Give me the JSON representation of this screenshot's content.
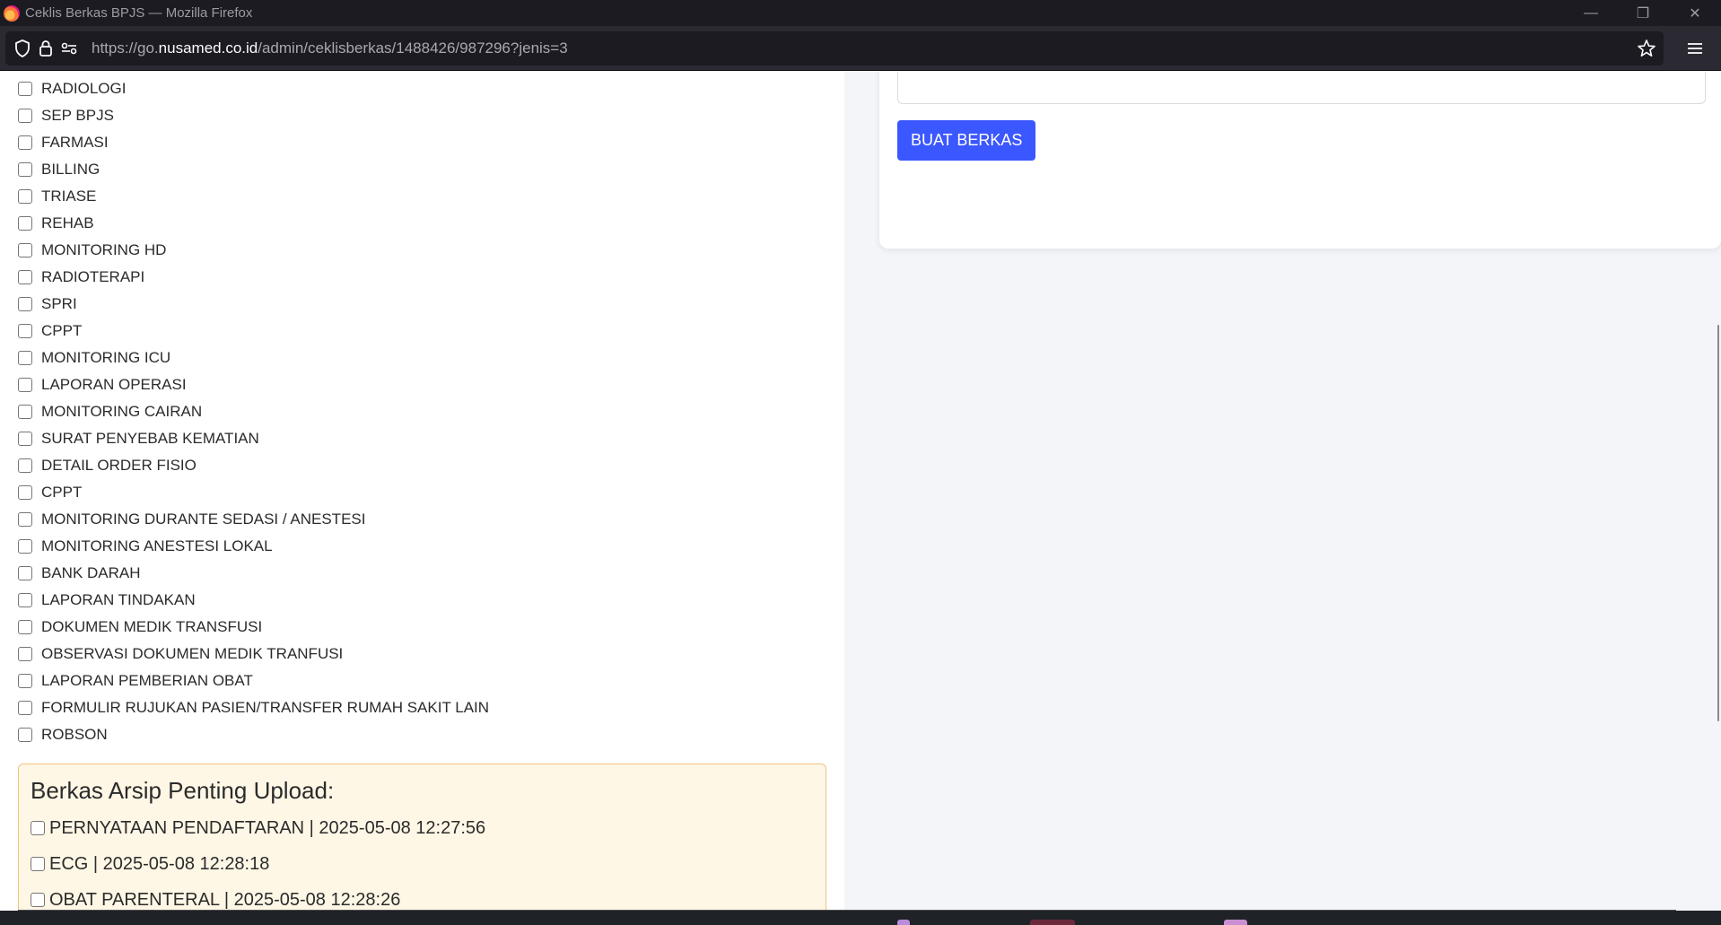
{
  "window": {
    "title": "Ceklis Berkas BPJS — Mozilla Firefox",
    "minimize": "—",
    "restore": "❐",
    "close": "✕"
  },
  "navbar": {
    "url_prefix": "https://go.",
    "url_host": "nusamed.co.id",
    "url_path": "/admin/ceklisberkas/1488426/987296?jenis=3"
  },
  "checklist": {
    "items": [
      {
        "label": "RADIOLOGI",
        "checked": false
      },
      {
        "label": "SEP BPJS",
        "checked": false
      },
      {
        "label": "FARMASI",
        "checked": false
      },
      {
        "label": "BILLING",
        "checked": false
      },
      {
        "label": "TRIASE",
        "checked": false
      },
      {
        "label": "REHAB",
        "checked": false
      },
      {
        "label": "MONITORING HD",
        "checked": false
      },
      {
        "label": "RADIOTERAPI",
        "checked": false
      },
      {
        "label": "SPRI",
        "checked": false
      },
      {
        "label": "CPPT",
        "checked": false
      },
      {
        "label": "MONITORING ICU",
        "checked": false
      },
      {
        "label": "LAPORAN OPERASI",
        "checked": false
      },
      {
        "label": "MONITORING CAIRAN",
        "checked": false
      },
      {
        "label": "SURAT PENYEBAB KEMATIAN",
        "checked": false
      },
      {
        "label": "DETAIL ORDER FISIO",
        "checked": false
      },
      {
        "label": "CPPT",
        "checked": false
      },
      {
        "label": "MONITORING DURANTE SEDASI / ANESTESI",
        "checked": false
      },
      {
        "label": "MONITORING ANESTESI LOKAL",
        "checked": false
      },
      {
        "label": "BANK DARAH",
        "checked": false
      },
      {
        "label": "LAPORAN TINDAKAN",
        "checked": false
      },
      {
        "label": "DOKUMEN MEDIK TRANSFUSI",
        "checked": false
      },
      {
        "label": "OBSERVASI DOKUMEN MEDIK TRANFUSI",
        "checked": false
      },
      {
        "label": "LAPORAN PEMBERIAN OBAT",
        "checked": false
      },
      {
        "label": "FORMULIR RUJUKAN PASIEN/TRANSFER RUMAH SAKIT LAIN",
        "checked": false
      },
      {
        "label": "ROBSON",
        "checked": false
      }
    ]
  },
  "archive": {
    "title": "Berkas Arsip Penting Upload:",
    "items": [
      {
        "label": "PERNYATAAN PENDAFTARAN | 2025-05-08 12:27:56",
        "checked": false
      },
      {
        "label": "ECG | 2025-05-08 12:28:18",
        "checked": false
      },
      {
        "label": "OBAT PARENTERAL | 2025-05-08 12:28:26",
        "checked": false
      }
    ]
  },
  "form": {
    "submit_label": "BUAT BERKAS"
  },
  "colors": {
    "primary_button": "#3b57ff",
    "archive_bg": "#fff7e6",
    "archive_border": "#f2c27d"
  }
}
